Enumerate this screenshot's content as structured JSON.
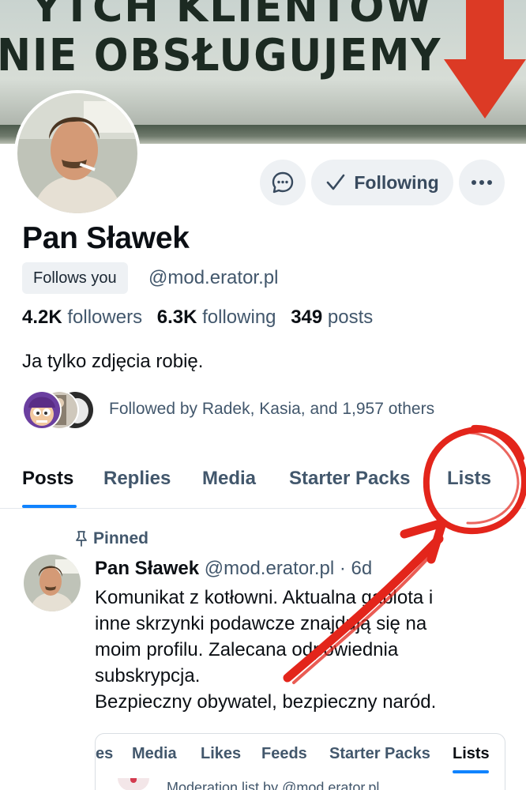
{
  "banner": {
    "sign_line1": "YTCH KLIENTÓW",
    "sign_line2": "NIE OBSŁUGUJEMY"
  },
  "profile": {
    "display_name": "Pan Sławek",
    "follows_you": "Follows you",
    "handle": "@mod.erator.pl",
    "stats": {
      "followers_count": "4.2K",
      "followers_label": "followers",
      "following_count": "6.3K",
      "following_label": "following",
      "posts_count": "349",
      "posts_label": "posts"
    },
    "bio": "Ja tylko zdjęcia robię.",
    "known_followers": "Followed by Radek, Kasia, and 1,957 others"
  },
  "actions": {
    "message_icon": "chat-bubble-icon",
    "following_label": "Following",
    "following_icon": "checkmark-icon",
    "more_icon": "ellipsis-icon"
  },
  "tabs": [
    {
      "label": "Posts",
      "active": true
    },
    {
      "label": "Replies",
      "active": false
    },
    {
      "label": "Media",
      "active": false
    },
    {
      "label": "Starter Packs",
      "active": false
    },
    {
      "label": "Lists",
      "active": false
    }
  ],
  "post": {
    "pinned_label": "Pinned",
    "pin_icon": "pin-icon",
    "author_name": "Pan Sławek",
    "author_handle": "@mod.erator.pl",
    "time": "· 6d",
    "lines": [
      "Komunikat z kotłowni. Aktualna gablota i",
      "inne skrzynki podawcze znajdują się na",
      "moim profilu. Zalecana odpowiednia",
      "subskrypcja.",
      "Bezpieczny obywatel, bezpieczny naród."
    ],
    "embed": {
      "tabs": [
        "es",
        "Media",
        "Likes",
        "Feeds",
        "Starter Packs",
        "Lists"
      ],
      "active_tab": "Lists",
      "subtitle": "Moderation list by @mod.erator.pl"
    }
  },
  "colors": {
    "accent": "#1083fe",
    "muted_text": "#42576c",
    "annotation": "#e3251b",
    "button_bg": "#eef1f4"
  }
}
